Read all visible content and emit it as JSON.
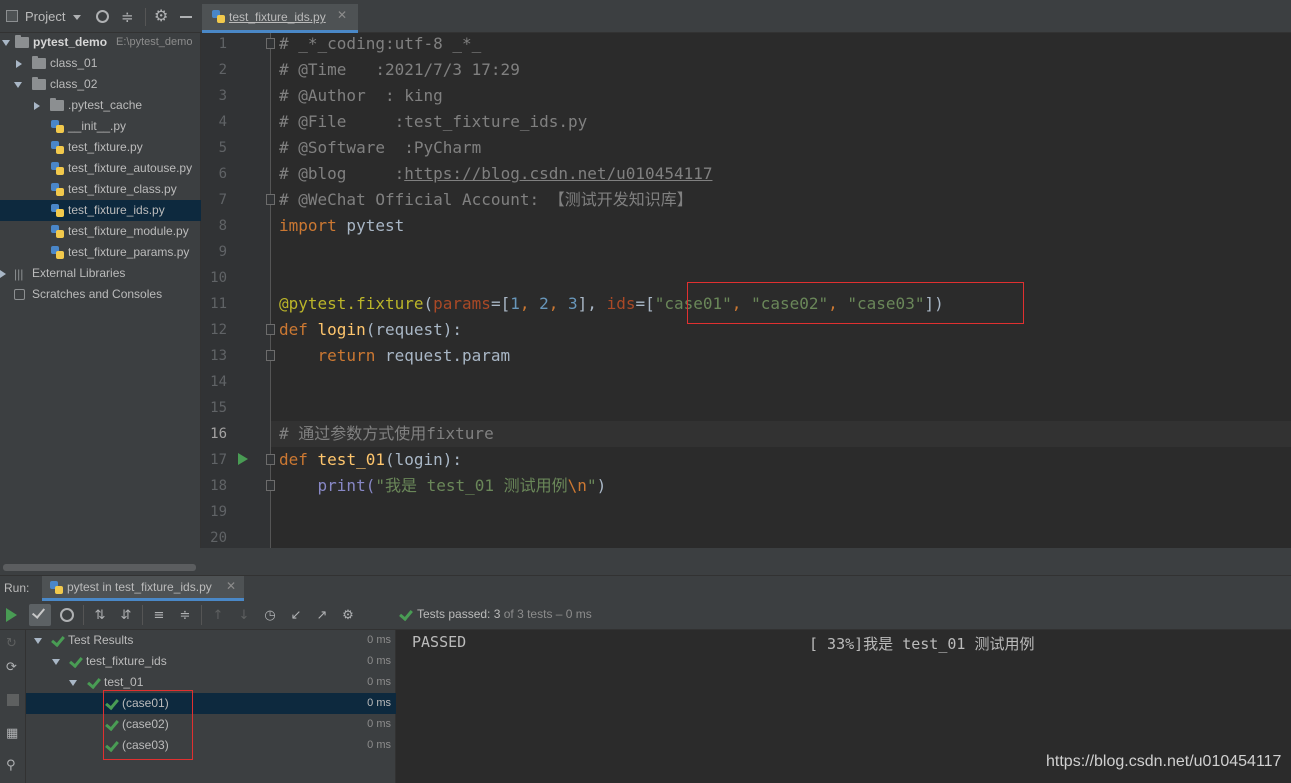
{
  "project": {
    "title": "Project",
    "root_name": "pytest_demo",
    "root_path": "E:\\pytest_demo",
    "items": [
      {
        "label": "class_01",
        "kind": "folder",
        "depth": 1,
        "state": "collapsed"
      },
      {
        "label": "class_02",
        "kind": "folder",
        "depth": 1,
        "state": "expanded"
      },
      {
        "label": ".pytest_cache",
        "kind": "folder",
        "depth": 2,
        "state": "collapsed"
      },
      {
        "label": "__init__.py",
        "kind": "py",
        "depth": 2
      },
      {
        "label": "test_fixture.py",
        "kind": "py",
        "depth": 2
      },
      {
        "label": "test_fixture_autouse.py",
        "kind": "py",
        "depth": 2
      },
      {
        "label": "test_fixture_class.py",
        "kind": "py",
        "depth": 2
      },
      {
        "label": "test_fixture_ids.py",
        "kind": "py",
        "depth": 2,
        "selected": true
      },
      {
        "label": "test_fixture_module.py",
        "kind": "py",
        "depth": 2
      },
      {
        "label": "test_fixture_params.py",
        "kind": "py",
        "depth": 2
      },
      {
        "label": "External Libraries",
        "kind": "lib",
        "depth": 0
      },
      {
        "label": "Scratches and Consoles",
        "kind": "scratch",
        "depth": 0
      }
    ]
  },
  "editor": {
    "tab_label": "test_fixture_ids.py",
    "line_numbers": [
      "1",
      "2",
      "3",
      "4",
      "5",
      "6",
      "7",
      "8",
      "9",
      "10",
      "11",
      "12",
      "13",
      "14",
      "15",
      "16",
      "17",
      "18",
      "19",
      "20"
    ],
    "current_line": "16",
    "lines": {
      "l1": "# _*_coding:utf-8 _*_",
      "l2": "# @Time   :2021/7/3 17:29",
      "l3": "# @Author  : king",
      "l4": "# @File     :test_fixture_ids.py",
      "l5": "# @Software  :PyCharm",
      "l6_pre": "# @blog     :",
      "l6_link": "https://blog.csdn.net/u010454117",
      "l7": "# @WeChat Official Account: 【测试开发知识库】",
      "l8_kw": "import",
      "l8_rest": " pytest",
      "l11_dec": "@pytest.fixture",
      "l11_p1": "(",
      "l11_param1": "params",
      "l11_p2": "=[",
      "l11_n1": "1",
      "l11_c1": ", ",
      "l11_n2": "2",
      "l11_c2": ", ",
      "l11_n3": "3",
      "l11_p3": "], ",
      "l11_param2": "ids",
      "l11_p4": "=[",
      "l11_s1": "\"case01\"",
      "l11_c3": ", ",
      "l11_s2": "\"case02\"",
      "l11_c4": ", ",
      "l11_s3": "\"case03\"",
      "l11_p5": "])",
      "l12_kw": "def",
      "l12_fn": " login",
      "l12_rest": "(request):",
      "l13_kw": "    return",
      "l13_rest": " request.param",
      "l16": "# 通过参数方式使用fixture",
      "l17_kw": "def",
      "l17_fn": " test_01",
      "l17_rest": "(login):",
      "l18_pre": "    print(",
      "l18_str": "\"我是 test_01 测试用例",
      "l18_esc": "\\n",
      "l18_end_q": "\"",
      "l18_end": ")"
    }
  },
  "run": {
    "label": "Run:",
    "tab_label": "pytest in test_fixture_ids.py",
    "status_prefix": "Tests passed:",
    "status_count": "3",
    "status_suffix": "of 3 tests – 0 ms",
    "tree": [
      {
        "label": "Test Results",
        "time": "0 ms",
        "depth": 0
      },
      {
        "label": "test_fixture_ids",
        "time": "0 ms",
        "depth": 1
      },
      {
        "label": "test_01",
        "time": "0 ms",
        "depth": 2
      },
      {
        "label": "(case01)",
        "time": "0 ms",
        "depth": 3,
        "selected": true
      },
      {
        "label": "(case02)",
        "time": "0 ms",
        "depth": 3
      },
      {
        "label": "(case03)",
        "time": "0 ms",
        "depth": 3
      }
    ],
    "console_status": "PASSED",
    "console_progress": "[ 33%]我是 test_01 测试用例"
  },
  "watermark": "https://blog.csdn.net/u010454117",
  "colors": {
    "accent": "#4a88c7",
    "pass_green": "#499c54",
    "highlight_red": "#e03030"
  }
}
